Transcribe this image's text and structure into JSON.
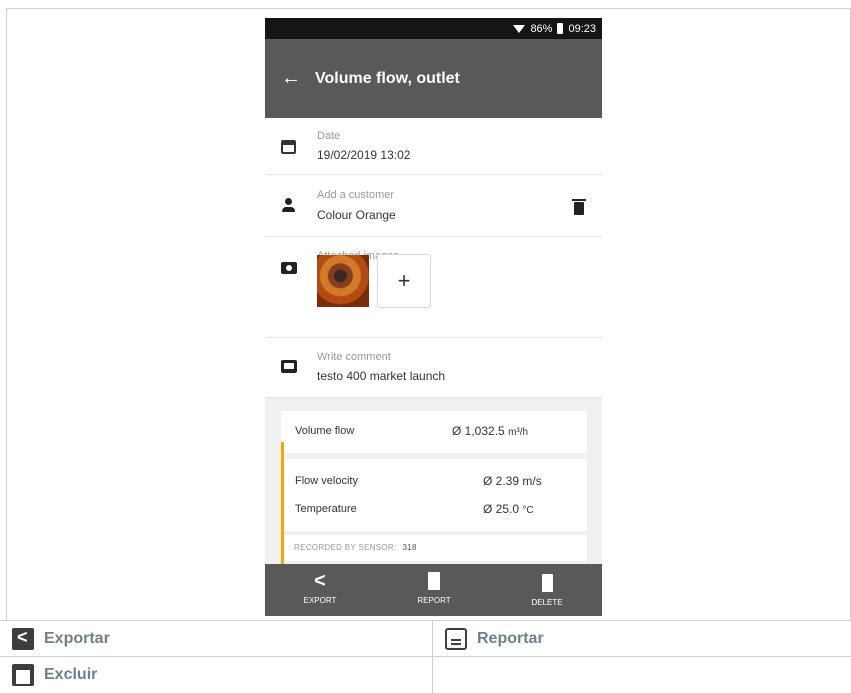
{
  "status_bar": {
    "battery": "86%",
    "time": "09:23"
  },
  "app_bar": {
    "back_icon": "arrow-left-icon",
    "title": "Volume flow, outlet"
  },
  "date_row": {
    "icon": "calendar-icon",
    "label": "Date",
    "value": "19/02/2019 13:02"
  },
  "customer_row": {
    "icon": "person-icon",
    "label": "Add a customer",
    "value": "Colour Orange",
    "action_icon": "trash-icon"
  },
  "images_row": {
    "icon": "camera-icon",
    "label": "Attached images",
    "add_label": "+"
  },
  "comment_row": {
    "icon": "comment-icon",
    "label": "Write comment",
    "value": "testo 400 market launch"
  },
  "measurements": {
    "volume_flow": {
      "label": "Volume flow",
      "value": "Ø 1,032.5",
      "unit": "m³/h"
    },
    "flow_velocity": {
      "label": "Flow velocity",
      "value": "Ø 2.39",
      "unit": "m/s"
    },
    "temperature": {
      "label": "Temperature",
      "value": "Ø 25.0",
      "unit": "°C"
    },
    "recorded_label": "RECORDED BY SENSOR:",
    "recorded_value": "318",
    "accent_color": "#f2a900"
  },
  "bottom_bar": {
    "export": {
      "icon": "share-icon",
      "label": "EXPORT"
    },
    "report": {
      "icon": "document-icon",
      "label": "REPORT"
    },
    "delete": {
      "icon": "trash-icon",
      "label": "DELETE"
    }
  },
  "legend": {
    "exportar": {
      "icon": "share-icon",
      "label": "Exportar"
    },
    "reportar": {
      "icon": "document-icon",
      "label": "Reportar"
    },
    "excluir": {
      "icon": "trash-icon",
      "label": "Excluir"
    }
  }
}
